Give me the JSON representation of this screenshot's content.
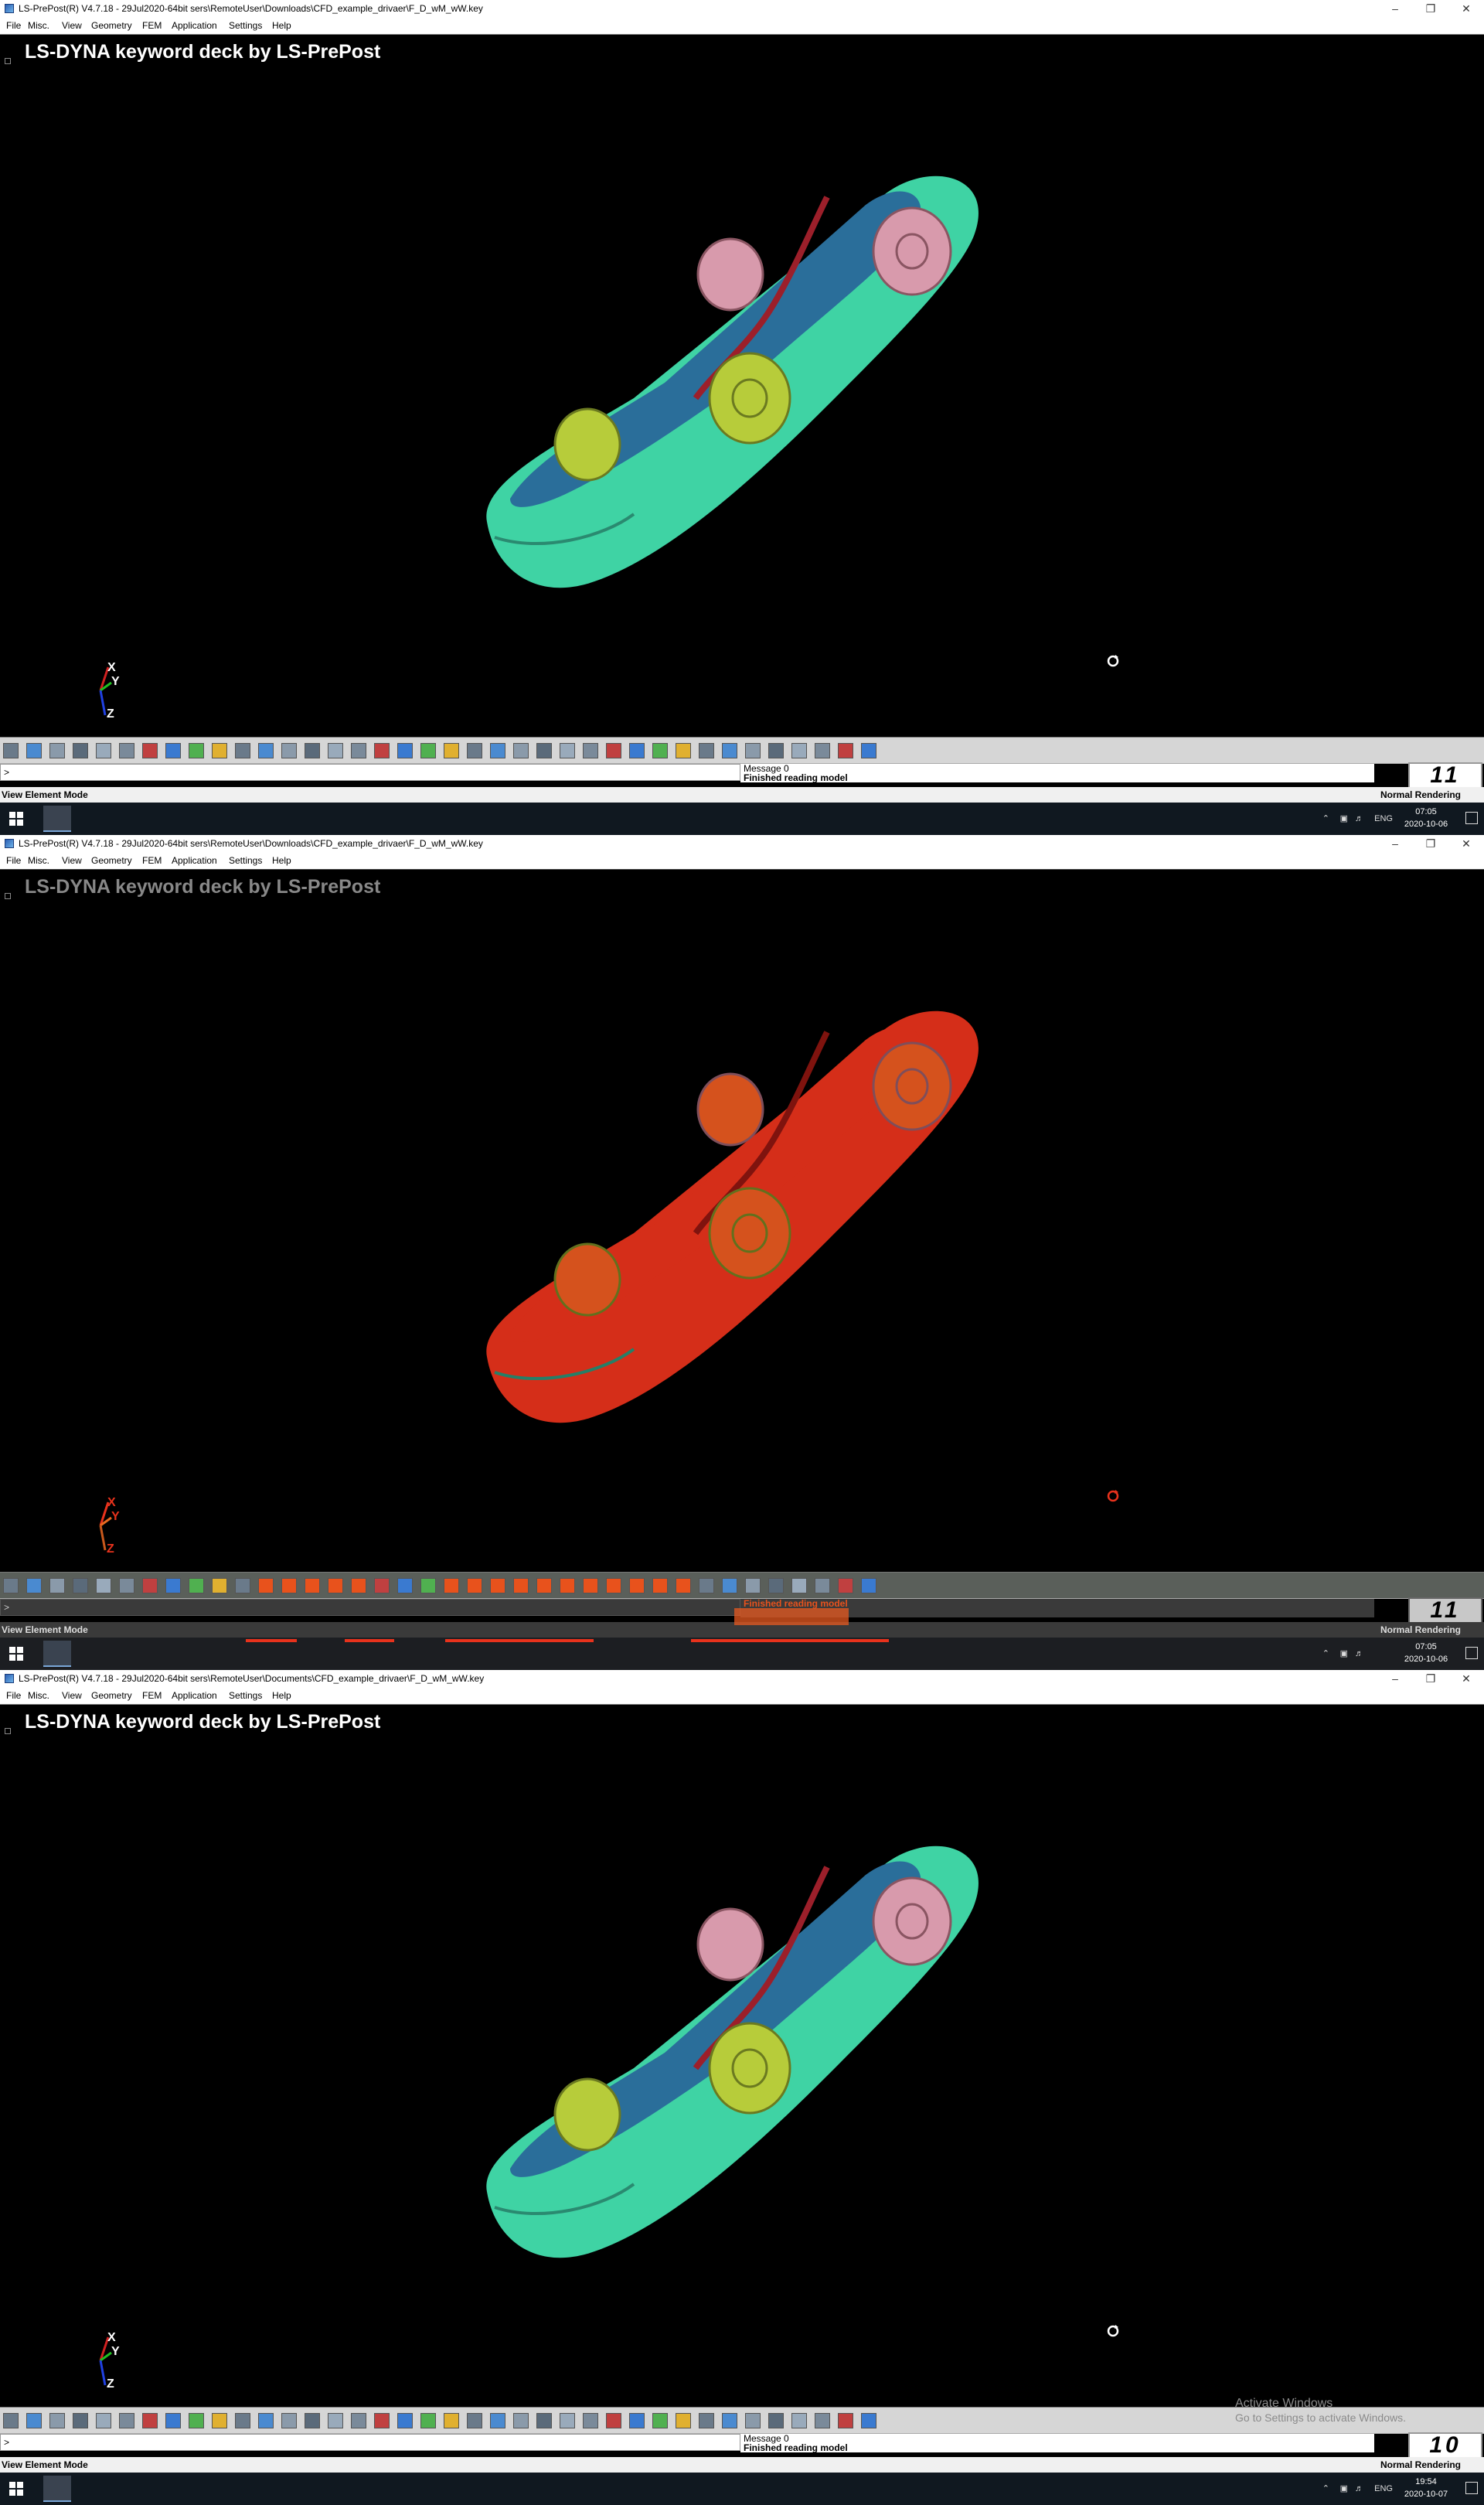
{
  "panels": [
    {
      "window_title": "LS-PrePost(R) V4.7.18 - 29Jul2020-64bit sers\\RemoteUser\\Downloads\\CFD_example_drivaer\\F_D_wM_wW.key",
      "menu": [
        "File",
        "Misc.",
        "View",
        "Geometry",
        "FEM",
        "Application",
        "Settings",
        "Help"
      ],
      "viewport_title": "LS-DYNA keyword deck by LS-PrePost",
      "triad": {
        "x": "X",
        "y": "Y",
        "z": "Z"
      },
      "command_prompt": ">",
      "messages": [
        "Message 0",
        "Finished reading model"
      ],
      "frame_counter": "11",
      "status_mode": "View Element Mode",
      "status_normal": "Normal Rendering",
      "tray_lang": "ENG",
      "clock_time": "07:05",
      "clock_date": "2020-10-06",
      "state": "normal"
    },
    {
      "window_title": "LS-PrePost(R) V4.7.18 - 29Jul2020-64bit sers\\RemoteUser\\Downloads\\CFD_example_drivaer\\F_D_wM_wW.key",
      "menu": [
        "File",
        "Misc.",
        "View",
        "Geometry",
        "FEM",
        "Application",
        "Settings",
        "Help"
      ],
      "viewport_title": "LS-DYNA keyword deck by LS-PrePost",
      "triad": {
        "x": "X",
        "y": "Y",
        "z": "Z"
      },
      "command_prompt": ">",
      "messages": [
        "",
        "Finished reading model"
      ],
      "frame_counter": "11",
      "status_mode": "View Element Mode",
      "status_normal": "Normal Rendering",
      "tray_lang": "",
      "clock_time": "07:05",
      "clock_date": "2020-10-06",
      "state": "highlighted"
    },
    {
      "window_title": "LS-PrePost(R) V4.7.18 - 29Jul2020-64bit sers\\RemoteUser\\Documents\\CFD_example_drivaer\\F_D_wM_wW.key",
      "menu": [
        "File",
        "Misc.",
        "View",
        "Geometry",
        "FEM",
        "Application",
        "Settings",
        "Help"
      ],
      "viewport_title": "LS-DYNA keyword deck by LS-PrePost",
      "triad": {
        "x": "X",
        "y": "Y",
        "z": "Z"
      },
      "command_prompt": ">",
      "messages": [
        "Message 0",
        "Finished reading model"
      ],
      "frame_counter": "10",
      "status_mode": "View Element Mode",
      "status_normal": "Normal Rendering",
      "tray_lang": "ENG",
      "clock_time": "19:54",
      "clock_date": "2020-10-07",
      "state": "normal",
      "watermark": [
        "Activate Windows",
        "Go to Settings to activate Windows."
      ]
    }
  ],
  "colors": {
    "body": "#3fd3a4",
    "underbody": "#2a6e9a",
    "wheel_front": "#b7cc3a",
    "wheel_rear": "#d89aac",
    "exhaust": "#9c1f2a",
    "glitch": "#e8321c"
  }
}
